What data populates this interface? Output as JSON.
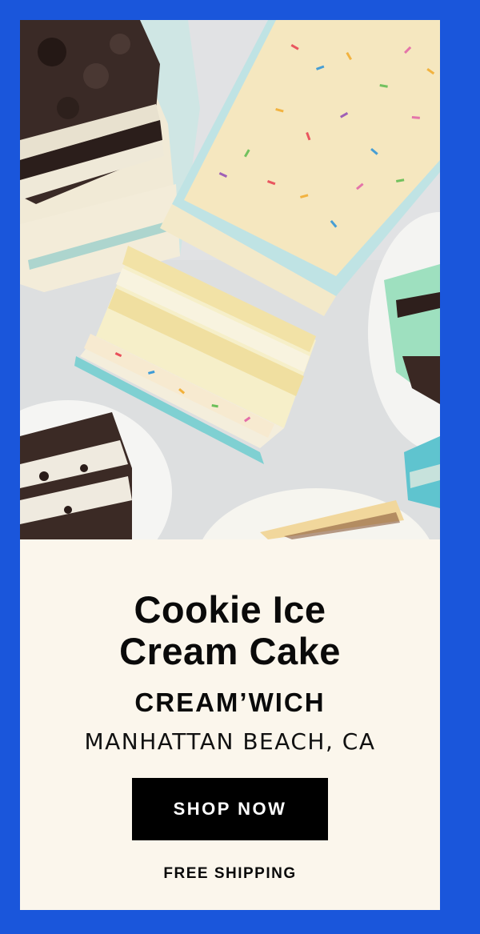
{
  "product": {
    "title_line1": "Cookie Ice",
    "title_line2": "Cream Cake",
    "brand": "CREAM’WICH",
    "location": "MANHATTAN BEACH, CA"
  },
  "cta": {
    "button_label": "SHOP NOW",
    "shipping_note": "FREE SHIPPING"
  },
  "colors": {
    "frame": "#1a56db",
    "card": "#fbf6ec",
    "button": "#000000",
    "button_text": "#ffffff"
  }
}
